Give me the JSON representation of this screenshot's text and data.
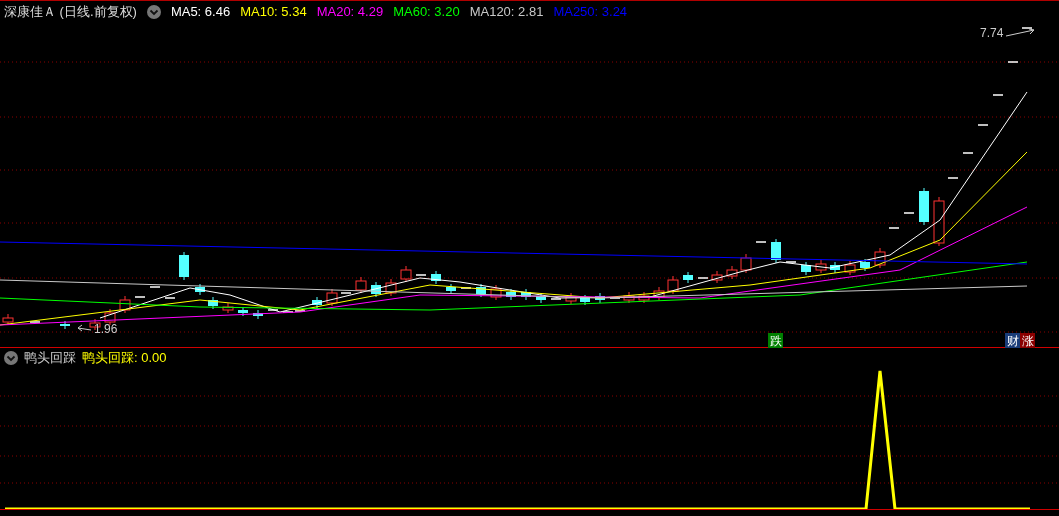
{
  "header": {
    "title": "深康佳Ａ (日线.前复权)",
    "ma": [
      {
        "label": "MA5: 6.46",
        "color": "#ffffff"
      },
      {
        "label": "MA10: 5.34",
        "color": "#ffff00"
      },
      {
        "label": "MA20: 4.29",
        "color": "#ff00ff"
      },
      {
        "label": "MA60: 3.20",
        "color": "#00ff00"
      },
      {
        "label": "MA120: 2.81",
        "color": "#c8c8c8"
      },
      {
        "label": "MA250: 3.24",
        "color": "#0000ff"
      }
    ]
  },
  "price_labels": {
    "high": "7.74",
    "low": "1.96"
  },
  "markers": [
    {
      "text": "跌",
      "color": "#008000"
    },
    {
      "text": "财",
      "color": "#1a3c78"
    },
    {
      "text": "涨",
      "color": "#8b0000"
    }
  ],
  "indicator": {
    "name": "鸭头回踩",
    "value": "鸭头回踩: 0.00"
  }
}
